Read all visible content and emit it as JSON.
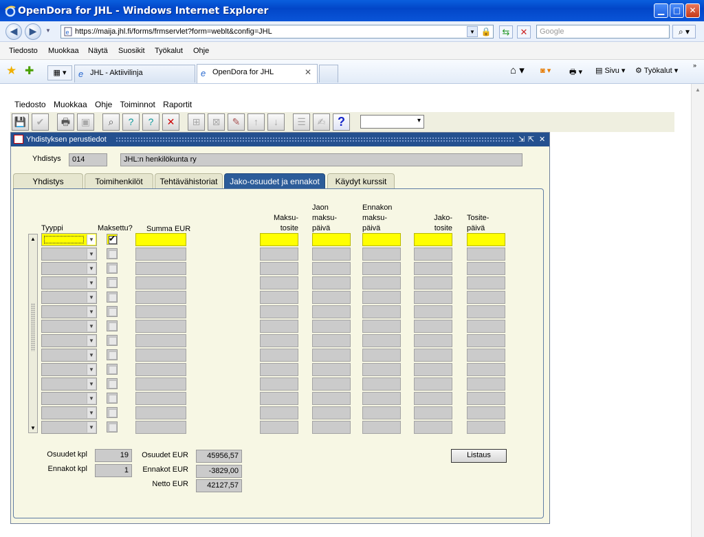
{
  "browser": {
    "window_title": "OpenDora for JHL - Windows Internet Explorer",
    "url": "https://maija.jhl.fi/forms/frmservlet?form=weblt&config=JHL",
    "search_placeholder": "Google",
    "menu": [
      "Tiedosto",
      "Muokkaa",
      "Näytä",
      "Suosikit",
      "Työkalut",
      "Ohje"
    ],
    "tabs": [
      {
        "label": "JHL - Aktiivilinja",
        "active": false
      },
      {
        "label": "OpenDora for JHL",
        "active": true
      }
    ],
    "commands": {
      "page": "Sivu",
      "tools": "Työkalut"
    }
  },
  "forms_menu": [
    "Tiedosto",
    "Muokkaa",
    "Ohje",
    "Toiminnot",
    "Raportit"
  ],
  "inner_window": {
    "title": "Yhdistyksen perustiedot",
    "yhdistys_label": "Yhdistys",
    "yhdistys_code": "014",
    "yhdistys_name": "JHL:n henkilökunta ry",
    "tabs": [
      "Yhdistys",
      "Toimihenkilöt",
      "Tehtävähistoriat",
      "Jako-osuudet ja ennakot",
      "Käydyt kurssit"
    ],
    "active_tab": 3
  },
  "grid": {
    "headers": {
      "tyyppi": "Tyyppi",
      "maksettu": "Maksettu?",
      "summa": "Summa EUR",
      "maksutosite": [
        "Maksu-",
        "tosite"
      ],
      "jaon_maksupaiva": [
        "Jaon",
        "maksu-",
        "päivä"
      ],
      "ennakon_maksupaiva": [
        "Ennakon",
        "maksu-",
        "päivä"
      ],
      "jakotosite": [
        "Jako-",
        "tosite"
      ],
      "tositepaiva": [
        "Tosite-",
        "päivä"
      ]
    },
    "row_count": 14,
    "first_row_checked": true
  },
  "summary": {
    "osuudet_kpl_label": "Osuudet kpl",
    "osuudet_kpl": "19",
    "ennakot_kpl_label": "Ennakot kpl",
    "ennakot_kpl": "1",
    "osuudet_eur_label": "Osuudet EUR",
    "osuudet_eur": "45956,57",
    "ennakot_eur_label": "Ennakot EUR",
    "ennakot_eur": "-3829,00",
    "netto_eur_label": "Netto EUR",
    "netto_eur": "42127,57",
    "listaus_button": "Listaus"
  }
}
